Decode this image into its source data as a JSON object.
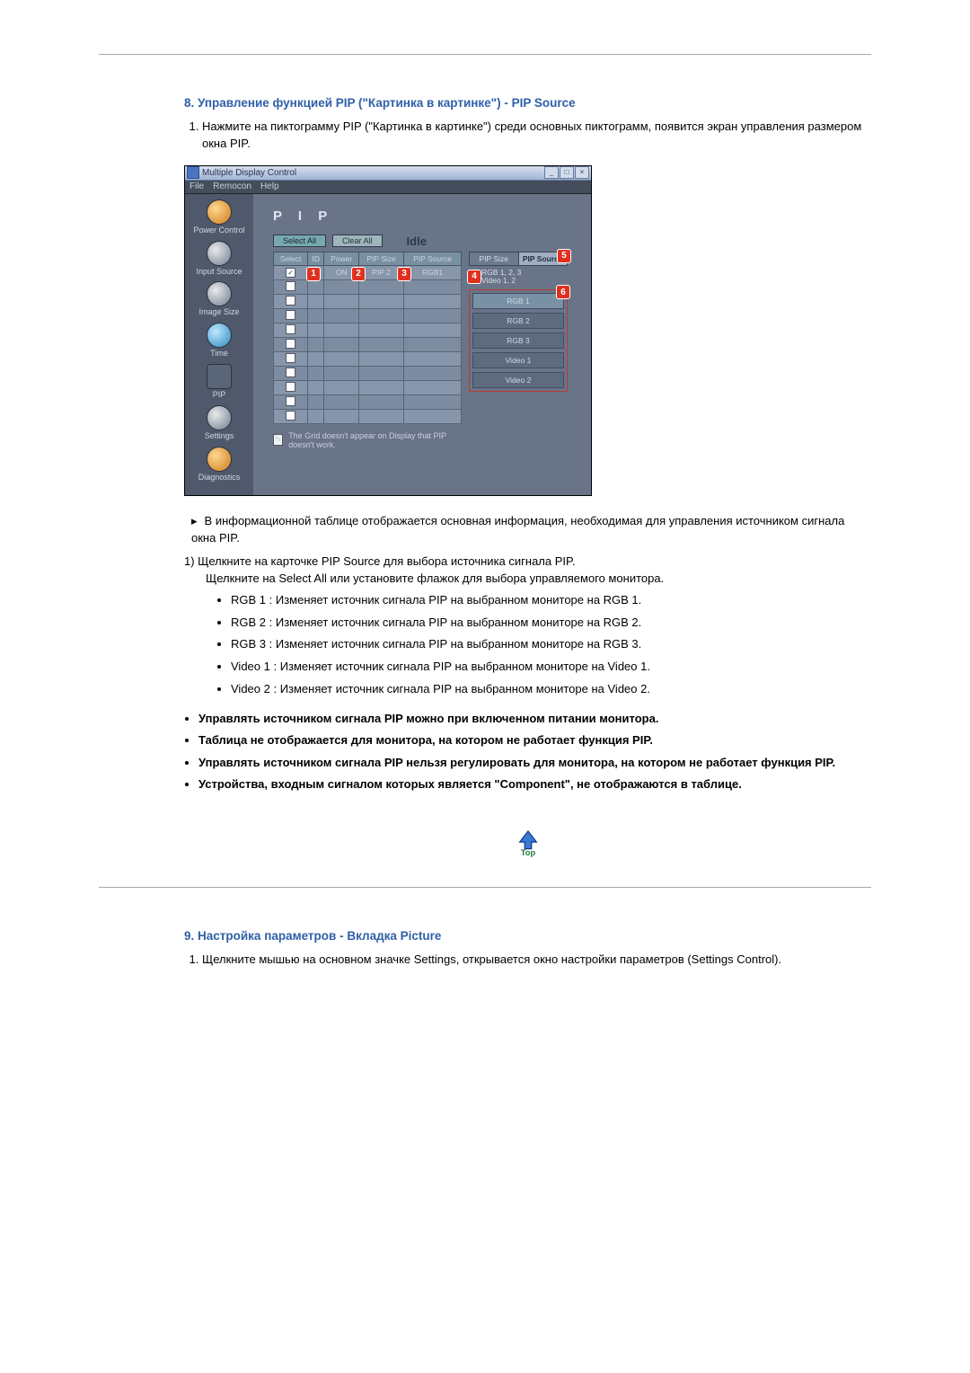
{
  "section8": {
    "heading": "8. Управление функцией PIP (\"Картинка в картинке\") - PIP Source",
    "step1": "Нажмите на пиктограмму PIP (\"Картинка в картинке\") среди основных пиктограмм, появится экран управления размером окна PIP."
  },
  "app": {
    "title": "Multiple Display Control",
    "menu": {
      "file": "File",
      "remocon": "Remocon",
      "help": "Help"
    },
    "sidebar": [
      "Power Control",
      "Input Source",
      "Image Size",
      "Time",
      "PIP",
      "Settings",
      "Diagnostics"
    ],
    "panelTitle": "P I P",
    "btnSelectAll": "Select All",
    "btnClearAll": "Clear All",
    "idle": "Idle",
    "headers": {
      "select": "Select",
      "id": "ID",
      "power": "Power",
      "pipsize": "PIP Size",
      "pipsrc": "PIP Source"
    },
    "row1": {
      "id": "1",
      "power": "ON",
      "size": "PIP 2",
      "src": "RGB1"
    },
    "tabs": {
      "pipsize": "PIP Size",
      "pipsource": "PIP Source"
    },
    "info": "RGB 1, 2, 3\nVideo 1, 2",
    "sources": [
      "RGB 1",
      "RGB 2",
      "RGB 3",
      "Video 1",
      "Video 2"
    ],
    "footnote": "The Grid doesn't appear on Display that PIP doesn't work."
  },
  "after": {
    "bullet": "В информационной таблице отображается основная информация, необходимая для управления источником сигнала окна PIP.",
    "line1a": "Щелкните на карточке PIP Source для выбора источника сигнала PIP.",
    "line1b": "Щелкните на Select All или установите флажок для выбора управляемого монитора.",
    "dots": [
      "RGB 1 : Изменяет источник сигнала PIP на выбранном мониторе на RGB 1.",
      "RGB 2 : Изменяет источник сигнала PIP на выбранном мониторе на RGB 2.",
      "RGB 3 : Изменяет источник сигнала PIP на выбранном мониторе на RGB 3.",
      "Video 1 : Изменяет источник сигнала PIP на выбранном мониторе на Video 1.",
      "Video 2 : Изменяет источник сигнала PIP на выбранном мониторе на Video 2."
    ],
    "bolds": [
      "Управлять источником сигнала PIP можно при включенном питании монитора.",
      "Таблица не отображается для монитора, на котором не работает функция PIP.",
      "Управлять источником сигнала PIP нельзя регулировать для монитора, на котором не работает функция PIP.",
      "Устройства, входным сигналом которых является \"Component\", не отображаются в таблице."
    ]
  },
  "topLabel": "Top",
  "section9": {
    "heading": "9. Настройка параметров - Вкладка Picture",
    "step1": "Щелкните мышью на основном значке Settings, открывается окно настройки параметров (Settings Control)."
  }
}
